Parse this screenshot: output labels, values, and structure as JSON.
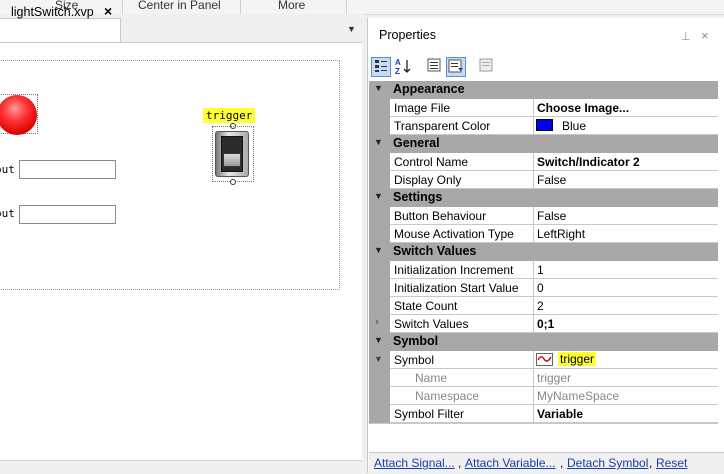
{
  "ribbon": {
    "items": [
      "Size",
      "Center in Panel",
      "More"
    ]
  },
  "document": {
    "tab_label": "lightSwitch.xvp",
    "tab_close_glyph": "×",
    "dropdown_glyph": "▼",
    "label_out_1": "out",
    "label_out_2": "out",
    "trigger_tag": "trigger"
  },
  "properties": {
    "title": "Properties",
    "pin_glyph": "⊥",
    "close_glyph": "×",
    "toolbar": [
      "categorized-icon",
      "alphabetical-icon",
      "properties-icon",
      "events-icon",
      "property-pages-icon"
    ],
    "categories": {
      "appearance": "Appearance",
      "general": "General",
      "settings": "Settings",
      "switch_values": "Switch Values",
      "symbol": "Symbol"
    },
    "rows": {
      "image_file": {
        "name": "Image File",
        "value": "Choose Image..."
      },
      "transparent_color": {
        "name": "Transparent Color",
        "value": "Blue",
        "swatch": "#0000ee"
      },
      "control_name": {
        "name": "Control Name",
        "value": "Switch/Indicator 2"
      },
      "display_only": {
        "name": "Display Only",
        "value": "False"
      },
      "button_behaviour": {
        "name": "Button Behaviour",
        "value": "False"
      },
      "mouse_activation": {
        "name": "Mouse Activation Type",
        "value": "LeftRight"
      },
      "init_increment": {
        "name": "Initialization Increment",
        "value": "1"
      },
      "init_start": {
        "name": "Initialization Start Value",
        "value": "0"
      },
      "state_count": {
        "name": "State Count",
        "value": "2"
      },
      "switch_values": {
        "name": "Switch Values",
        "value": "0;1"
      },
      "symbol": {
        "name": "Symbol",
        "value": "trigger"
      },
      "sym_name": {
        "name": "Name",
        "value": "trigger"
      },
      "sym_namespace": {
        "name": "Namespace",
        "value": "MyNameSpace"
      },
      "symbol_filter": {
        "name": "Symbol Filter",
        "value": "Variable"
      }
    },
    "links": {
      "attach_signal": "Attach Signal...",
      "attach_variable": "Attach Variable...",
      "detach_symbol": "Detach Symbol",
      "reset": "Reset"
    }
  }
}
